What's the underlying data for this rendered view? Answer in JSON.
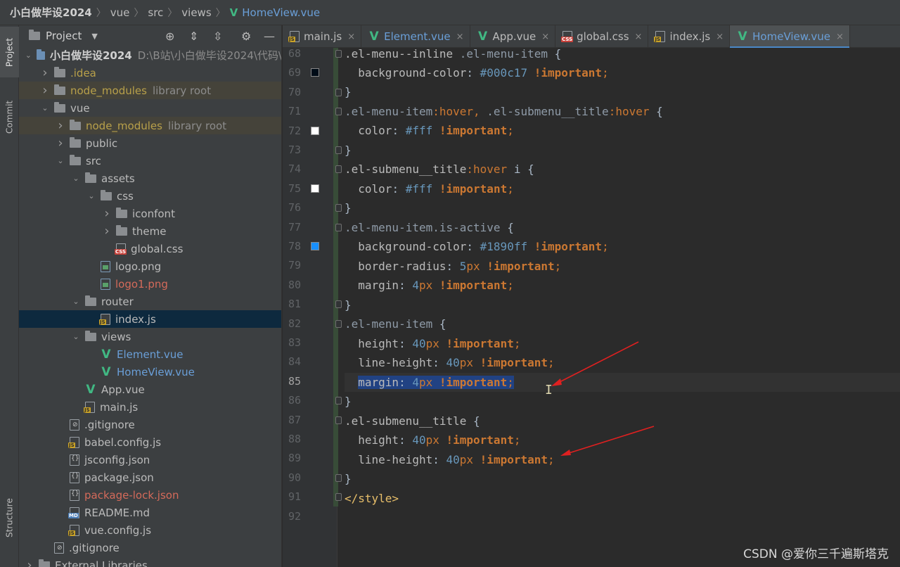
{
  "breadcrumb": {
    "project": "小白做毕设2024",
    "dir1": "vue",
    "dir2": "src",
    "dir3": "views",
    "file": "HomeView.vue"
  },
  "toolstrip": {
    "project": "Project",
    "commit": "Commit",
    "structure": "Structure"
  },
  "panel": {
    "title": "Project"
  },
  "tree": [
    {
      "label": "小白做毕设2024",
      "suffix": "D:\\B站\\小白做毕设2024\\代码\\",
      "kind": "root"
    },
    {
      "label": ".idea",
      "kind": "idea"
    },
    {
      "label": "node_modules",
      "suffix": "library root",
      "kind": "nm"
    },
    {
      "label": "vue",
      "kind": "folder"
    },
    {
      "label": "node_modules",
      "suffix": "library root",
      "kind": "nm"
    },
    {
      "label": "public",
      "kind": "folder"
    },
    {
      "label": "src",
      "kind": "folder"
    },
    {
      "label": "assets",
      "kind": "folder"
    },
    {
      "label": "css",
      "kind": "folder"
    },
    {
      "label": "iconfont",
      "kind": "folder"
    },
    {
      "label": "theme",
      "kind": "folder"
    },
    {
      "label": "global.css",
      "kind": "css"
    },
    {
      "label": "logo.png",
      "kind": "img"
    },
    {
      "label": "logo1.png",
      "kind": "img-red"
    },
    {
      "label": "router",
      "kind": "folder"
    },
    {
      "label": "index.js",
      "kind": "js"
    },
    {
      "label": "views",
      "kind": "folder"
    },
    {
      "label": "Element.vue",
      "kind": "vue"
    },
    {
      "label": "HomeView.vue",
      "kind": "vue"
    },
    {
      "label": "App.vue",
      "kind": "vue-plain"
    },
    {
      "label": "main.js",
      "kind": "js"
    },
    {
      "label": ".gitignore",
      "kind": "git"
    },
    {
      "label": "babel.config.js",
      "kind": "js"
    },
    {
      "label": "jsconfig.json",
      "kind": "json"
    },
    {
      "label": "package.json",
      "kind": "json"
    },
    {
      "label": "package-lock.json",
      "kind": "json-red"
    },
    {
      "label": "README.md",
      "kind": "md"
    },
    {
      "label": "vue.config.js",
      "kind": "js"
    },
    {
      "label": ".gitignore",
      "kind": "git"
    },
    {
      "label": "External Libraries",
      "kind": "ext"
    }
  ],
  "tabs": [
    {
      "label": "main.js",
      "kind": "js"
    },
    {
      "label": "Element.vue",
      "kind": "vue"
    },
    {
      "label": "App.vue",
      "kind": "vue-plain"
    },
    {
      "label": "global.css",
      "kind": "css"
    },
    {
      "label": "index.js",
      "kind": "js"
    },
    {
      "label": "HomeView.vue",
      "kind": "vue"
    }
  ],
  "tab_close": "×",
  "code": {
    "line_numbers": [
      "68",
      "69",
      "70",
      "71",
      "72",
      "73",
      "74",
      "75",
      "76",
      "77",
      "78",
      "79",
      "80",
      "81",
      "82",
      "83",
      "84",
      "85",
      "86",
      "87",
      "88",
      "89",
      "90",
      "91",
      "92"
    ],
    "current_line": "85",
    "colors": {
      "c000c17": "#000c17",
      "cfff": "#ffffff",
      "c1890ff": "#1890ff"
    }
  },
  "watermark": "CSDN @爱你三千遍斯塔克"
}
